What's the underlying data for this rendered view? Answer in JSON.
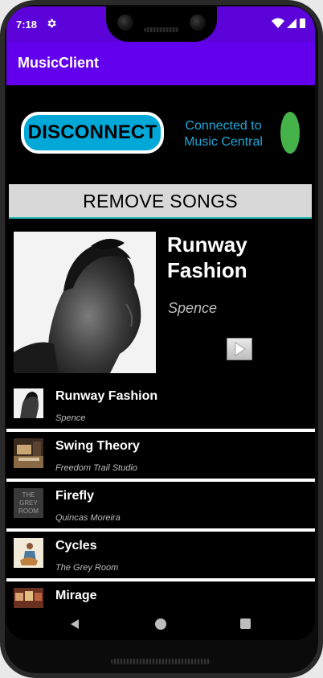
{
  "status_bar": {
    "time": "7:18",
    "color": "#5b03d8"
  },
  "app_bar": {
    "title": "MusicClient",
    "color": "#6200ee"
  },
  "connection": {
    "disconnect_label": "DISCONNECT",
    "status_text": "Connected to Music Central",
    "indicator_color": "#45b34a"
  },
  "remove_songs_label": "REMOVE SONGS",
  "now_playing": {
    "title": "Runway Fashion",
    "artist": "Spence"
  },
  "songs": [
    {
      "title": "Runway Fashion",
      "artist": "Spence"
    },
    {
      "title": "Swing Theory",
      "artist": "Freedom Trail Studio"
    },
    {
      "title": "Firefly",
      "artist": "Quincas Moreira"
    },
    {
      "title": "Cycles",
      "artist": "The Grey Room"
    },
    {
      "title": "Mirage",
      "artist": ""
    }
  ],
  "firefly_thumb_text": "THE GREY ROOM",
  "icons": {
    "settings": "gear-icon",
    "wifi": "wifi-icon",
    "signal": "signal-icon",
    "battery": "battery-icon",
    "play": "play-icon",
    "back": "back-icon",
    "home": "home-icon",
    "recents": "recents-icon"
  }
}
